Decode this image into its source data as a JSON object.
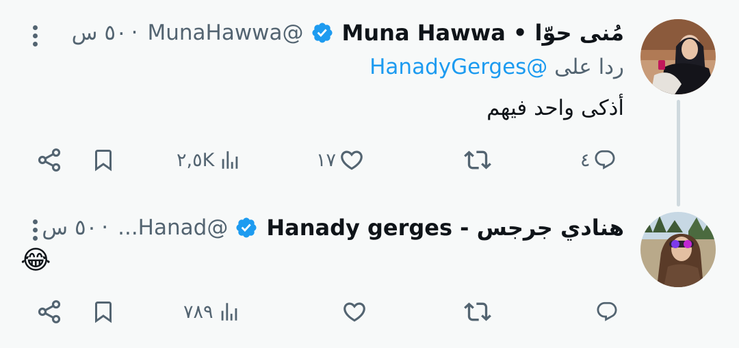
{
  "tweets": [
    {
      "name": "مُنى حوّا • Muna Hawwa",
      "handle": "@MunaHawwa",
      "time": "٥٠ س",
      "reply_prefix": "ردا على",
      "reply_mention": "@HanadyGerges",
      "text": "أذكى واحد فيهم",
      "replies": "٤",
      "retweets": "",
      "likes": "١٧",
      "views": "٢,٥K"
    },
    {
      "name": "هنادي جرجس - Hanady gerges",
      "handle": "@Hanad...",
      "time": "٥٠ س",
      "text": "😂",
      "replies": "",
      "retweets": "",
      "likes": "",
      "views": "٧٨٩"
    }
  ],
  "colors": {
    "accent": "#1d9bf0",
    "muted": "#536471",
    "text": "#0f1419",
    "background": "#f7f9f9"
  },
  "icons": [
    "more-icon",
    "verified-badge-icon",
    "reply-icon",
    "retweet-icon",
    "like-icon",
    "views-icon",
    "bookmark-icon",
    "share-icon"
  ]
}
